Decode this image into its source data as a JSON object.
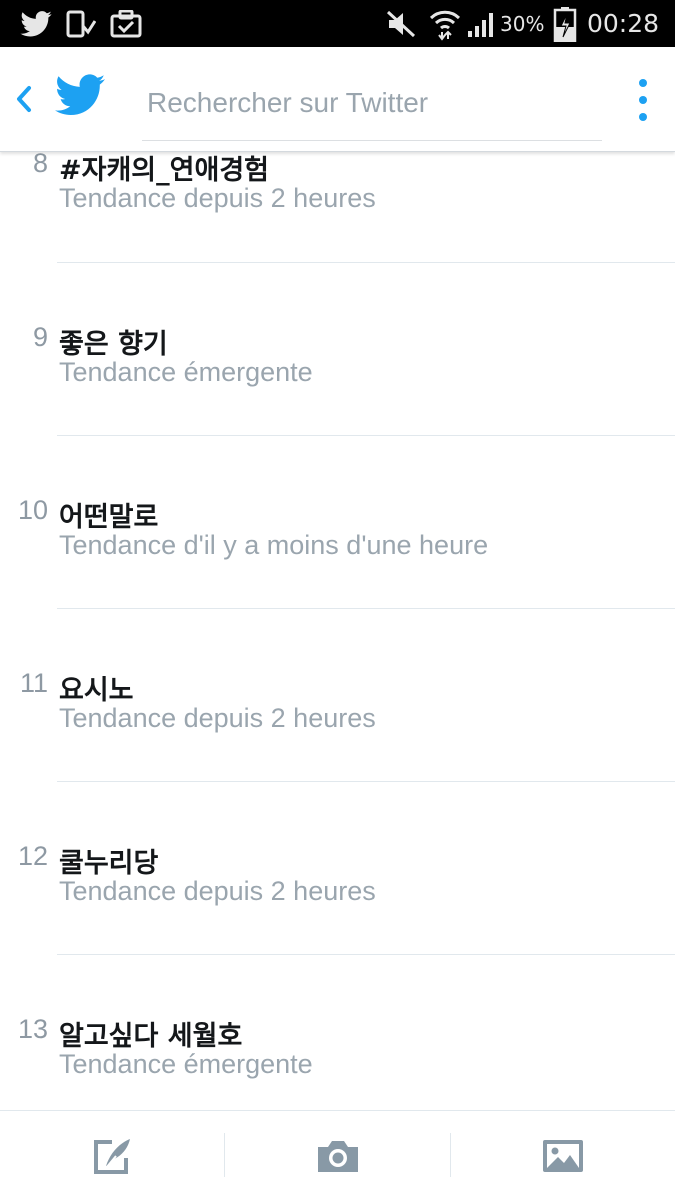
{
  "status_bar": {
    "battery": "30%",
    "time": "00:28",
    "icons": [
      "twitter-icon",
      "phone-download-icon",
      "clipboard-check-icon",
      "mute-icon",
      "wifi-icon",
      "signal-icon",
      "battery-charging-icon"
    ]
  },
  "toolbar": {
    "search_placeholder": "Rechercher sur Twitter",
    "search_value": "",
    "icons": [
      "back-arrow-icon",
      "twitter-logo-icon",
      "overflow-menu-icon"
    ],
    "accent_color": "#1da1f2"
  },
  "trends": [
    {
      "rank": "8",
      "name": "#자캐의_연애경험",
      "meta": "Tendance depuis 2 heures"
    },
    {
      "rank": "9",
      "name": "좋은 향기",
      "meta": "Tendance émergente"
    },
    {
      "rank": "10",
      "name": "어떤말로",
      "meta": "Tendance d'il y a moins d'une heure"
    },
    {
      "rank": "11",
      "name": "요시노",
      "meta": "Tendance depuis 2 heures"
    },
    {
      "rank": "12",
      "name": "쿨누리당",
      "meta": "Tendance depuis 2 heures"
    },
    {
      "rank": "13",
      "name": "알고싶다 세월호",
      "meta": "Tendance émergente"
    }
  ],
  "bottom_bar": {
    "icons": [
      "compose-tweet-icon",
      "camera-icon",
      "gallery-icon"
    ],
    "icon_color": "#8899a6"
  }
}
